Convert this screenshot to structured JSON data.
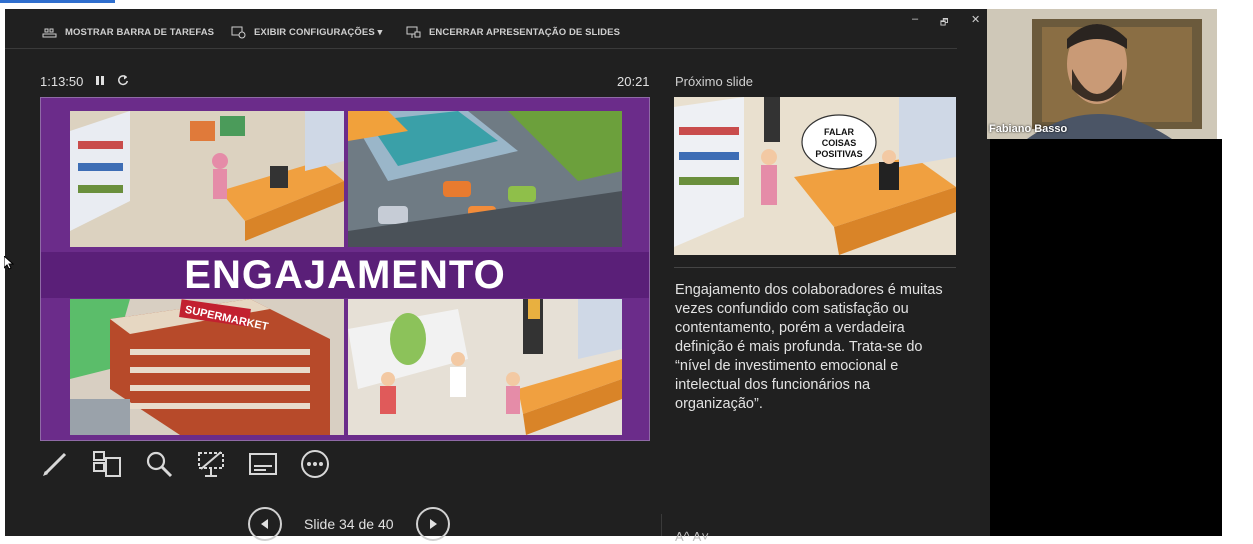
{
  "toolbar": {
    "show_taskbar": "MOSTRAR BARRA DE TAREFAS",
    "display_settings": "EXIBIR CONFIGURAÇÕES ▾",
    "end_slideshow": "ENCERRAR APRESENTAÇÃO DE SLIDES"
  },
  "window": {
    "minimize": "–",
    "restore": "🗗",
    "close": "✕"
  },
  "timer": {
    "elapsed": "1:13:50",
    "pause_icon": "pause-icon",
    "reset_icon": "reset-icon"
  },
  "clock": "20:21",
  "current_slide": {
    "title": "ENGAJAMENTO",
    "building_sign": "SUPERMARKET",
    "colors": {
      "background": "#6b2c8a",
      "title_band": "#5a1f78"
    }
  },
  "tools": [
    "pen-icon",
    "see-all-slides-icon",
    "zoom-icon",
    "pointer-screen-icon",
    "subtitles-icon",
    "more-options-icon"
  ],
  "navigation": {
    "label": "Slide 34 de 40",
    "prev_icon": "chevron-left-icon",
    "next_icon": "chevron-right-icon"
  },
  "next_slide": {
    "label": "Próximo slide",
    "bubble_text": "FALAR\nCOISAS\nPOSITIVAS"
  },
  "notes": {
    "text": "Engajamento dos colaboradores é muitas vezes confundido com satisfação ou contentamento, porém a verdadeira definição é mais profunda. Trata-se do “nível de investimento emocional e intelectual dos funcionários na organização”.",
    "more_indicator": "A^ A˅"
  },
  "video": {
    "participant_name": "Fabiano Basso"
  }
}
